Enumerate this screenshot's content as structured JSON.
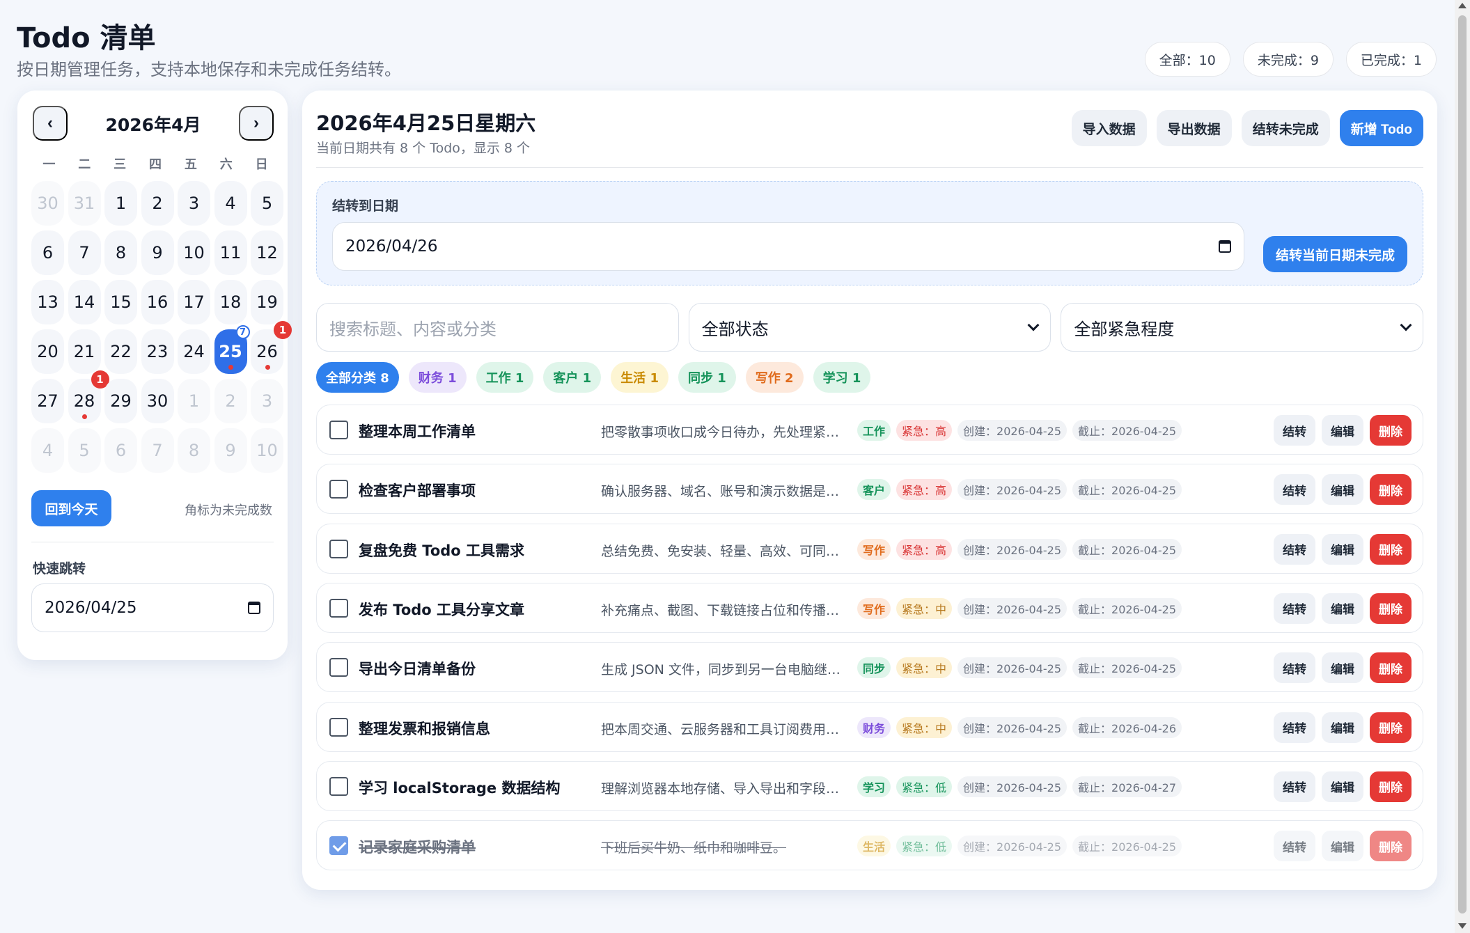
{
  "header": {
    "title": "Todo 清单",
    "subtitle": "按日期管理任务，支持本地保存和未完成任务结转。"
  },
  "stats": {
    "all": "全部：10",
    "pending": "未完成：9",
    "done": "已完成：1"
  },
  "calendar": {
    "month_label": "2026年4月",
    "prev": "‹",
    "next": "›",
    "weekdays": [
      "一",
      "二",
      "三",
      "四",
      "五",
      "六",
      "日"
    ],
    "weeks": [
      [
        "30",
        "31",
        "1",
        "2",
        "3",
        "4",
        "5"
      ],
      [
        "6",
        "7",
        "8",
        "9",
        "10",
        "11",
        "12"
      ],
      [
        "13",
        "14",
        "15",
        "16",
        "17",
        "18",
        "19"
      ],
      [
        "20",
        "21",
        "22",
        "23",
        "24",
        "25",
        "26"
      ],
      [
        "27",
        "28",
        "29",
        "30",
        "1",
        "2",
        "3"
      ],
      [
        "4",
        "5",
        "6",
        "7",
        "8",
        "9",
        "10"
      ]
    ],
    "badge_today": "7",
    "badge_26": "1",
    "badge_28": "1",
    "today_button": "回到今天",
    "hint": "角标为未完成数",
    "quick_label": "快速跳转",
    "quick_value": "2026/04/25"
  },
  "main": {
    "date_title": "2026年4月25日星期六",
    "date_sub": "当前日期共有 8 个 Todo，显示 8 个",
    "actions": {
      "import": "导入数据",
      "export": "导出数据",
      "carry": "结转未完成",
      "add": "新增 Todo"
    },
    "carry_panel": {
      "label": "结转到日期",
      "value": "2026/04/26",
      "button": "结转当前日期未完成"
    },
    "filters": {
      "search_placeholder": "搜索标题、内容或分类",
      "status": "全部状态",
      "urgency": "全部紧急程度"
    },
    "chips": [
      {
        "label": "全部分类 8",
        "bg": "#2f80ed",
        "fg": "#ffffff"
      },
      {
        "label": "财务 1",
        "bg": "#ede7fb",
        "fg": "#7c4ddb"
      },
      {
        "label": "工作 1",
        "bg": "#dff5ea",
        "fg": "#15935a"
      },
      {
        "label": "客户 1",
        "bg": "#dff5ea",
        "fg": "#15935a"
      },
      {
        "label": "生活 1",
        "bg": "#fdf5d3",
        "fg": "#c98a00"
      },
      {
        "label": "同步 1",
        "bg": "#dff5ea",
        "fg": "#15935a"
      },
      {
        "label": "写作 2",
        "bg": "#fde9dc",
        "fg": "#e06b1c"
      },
      {
        "label": "学习 1",
        "bg": "#dff5ea",
        "fg": "#15935a"
      }
    ],
    "todos": [
      {
        "title": "整理本周工作清单",
        "desc": "把零散事项收口成今日待办，先处理紧急事项。",
        "category": "工作",
        "cat_bg": "#dff5ea",
        "cat_fg": "#15935a",
        "urgency": "紧急：高",
        "urg_bg": "#fde2e2",
        "urg_fg": "#d93636",
        "created": "创建：2026-04-25",
        "due": "截止：2026-04-25",
        "done": false
      },
      {
        "title": "检查客户部署事项",
        "desc": "确认服务器、域名、账号和演示数据是否就绪。",
        "category": "客户",
        "cat_bg": "#dff5ea",
        "cat_fg": "#15935a",
        "urgency": "紧急：高",
        "urg_bg": "#fde2e2",
        "urg_fg": "#d93636",
        "created": "创建：2026-04-25",
        "due": "截止：2026-04-25",
        "done": false
      },
      {
        "title": "复盘免费 Todo 工具需求",
        "desc": "总结免费、免安装、轻量、高效、可同步的诉求。",
        "category": "写作",
        "cat_bg": "#fde9dc",
        "cat_fg": "#e06b1c",
        "urgency": "紧急：高",
        "urg_bg": "#fde2e2",
        "urg_fg": "#d93636",
        "created": "创建：2026-04-25",
        "due": "截止：2026-04-25",
        "done": false
      },
      {
        "title": "发布 Todo 工具分享文章",
        "desc": "补充痛点、截图、下载链接占位和传播文案。",
        "category": "写作",
        "cat_bg": "#fde9dc",
        "cat_fg": "#e06b1c",
        "urgency": "紧急：中",
        "urg_bg": "#fdf1d3",
        "urg_fg": "#b7791f",
        "created": "创建：2026-04-25",
        "due": "截止：2026-04-25",
        "done": false
      },
      {
        "title": "导出今日清单备份",
        "desc": "生成 JSON 文件，同步到另一台电脑继续处理。",
        "category": "同步",
        "cat_bg": "#dff5ea",
        "cat_fg": "#15935a",
        "urgency": "紧急：中",
        "urg_bg": "#fdf1d3",
        "urg_fg": "#b7791f",
        "created": "创建：2026-04-25",
        "due": "截止：2026-04-25",
        "done": false
      },
      {
        "title": "整理发票和报销信息",
        "desc": "把本周交通、云服务器和工具订阅费用整理好。",
        "category": "财务",
        "cat_bg": "#ede7fb",
        "cat_fg": "#7c4ddb",
        "urgency": "紧急：中",
        "urg_bg": "#fdf1d3",
        "urg_fg": "#b7791f",
        "created": "创建：2026-04-25",
        "due": "截止：2026-04-26",
        "done": false
      },
      {
        "title": "学习 localStorage 数据结构",
        "desc": "理解浏览器本地存储、导入导出和字段设计。",
        "category": "学习",
        "cat_bg": "#dff5ea",
        "cat_fg": "#15935a",
        "urgency": "紧急：低",
        "urg_bg": "#dff5ea",
        "urg_fg": "#15935a",
        "created": "创建：2026-04-25",
        "due": "截止：2026-04-27",
        "done": false
      },
      {
        "title": "记录家庭采购清单",
        "desc": "下班后买牛奶、纸巾和咖啡豆。",
        "category": "生活",
        "cat_bg": "#fdf5d3",
        "cat_fg": "#c98a00",
        "urgency": "紧急：低",
        "urg_bg": "#dff5ea",
        "urg_fg": "#15935a",
        "created": "创建：2026-04-25",
        "due": "截止：2026-04-25",
        "done": true
      }
    ],
    "row_buttons": {
      "carry": "结转",
      "edit": "编辑",
      "delete": "删除"
    }
  }
}
